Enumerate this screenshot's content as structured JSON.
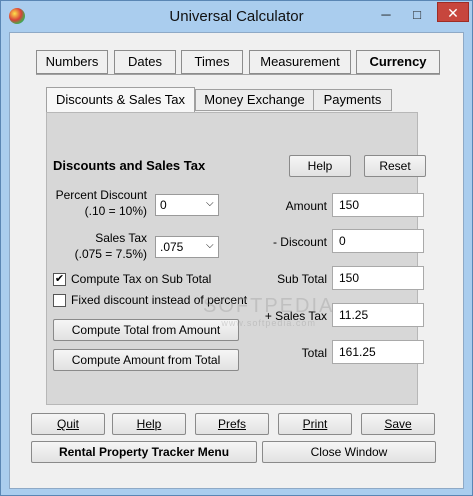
{
  "window": {
    "title": "Universal Calculator",
    "minimize_glyph": "─",
    "maximize_glyph": "□",
    "close_glyph": "✕"
  },
  "tabs": [
    {
      "label": "Numbers"
    },
    {
      "label": "Dates"
    },
    {
      "label": "Times"
    },
    {
      "label": "Measurement"
    },
    {
      "label": "Currency",
      "active": true
    }
  ],
  "subtabs": [
    {
      "label": "Discounts & Sales Tax",
      "active": true
    },
    {
      "label": "Money Exchange"
    },
    {
      "label": "Payments"
    }
  ],
  "panel": {
    "title": "Discounts and Sales Tax",
    "help_label": "Help",
    "reset_label": "Reset",
    "percent_discount": {
      "label": "Percent Discount",
      "hint": "(.10 = 10%)",
      "value": "0"
    },
    "sales_tax": {
      "label": "Sales Tax",
      "hint": "(.075 = 7.5%)",
      "value": ".075"
    },
    "compute_tax_on_subtotal": {
      "label": "Compute Tax on Sub Total",
      "checked": true,
      "mark": "✔"
    },
    "fixed_discount": {
      "label": "Fixed discount instead of percent",
      "checked": false
    },
    "compute_total_label": "Compute Total from Amount",
    "compute_amount_label": "Compute Amount from Total",
    "fields": {
      "amount": {
        "label": "Amount",
        "value": "150"
      },
      "discount": {
        "label": "- Discount",
        "value": "0"
      },
      "subtotal": {
        "label": "Sub Total",
        "value": "150"
      },
      "sales_tax": {
        "label": "+ Sales Tax",
        "value": "11.25"
      },
      "total": {
        "label": "Total",
        "value": "161.25"
      }
    }
  },
  "watermark": {
    "text": "SOFTPEDIA",
    "sub": "www.softpedia.com"
  },
  "bottom": {
    "quit": "Quit",
    "help": "Help",
    "prefs": "Prefs",
    "print": "Print",
    "save": "Save",
    "menu": "Rental Property Tracker Menu",
    "close_window": "Close Window"
  },
  "icons": {
    "dropdown": "chevron-down-icon",
    "app": "app-logo-icon"
  }
}
